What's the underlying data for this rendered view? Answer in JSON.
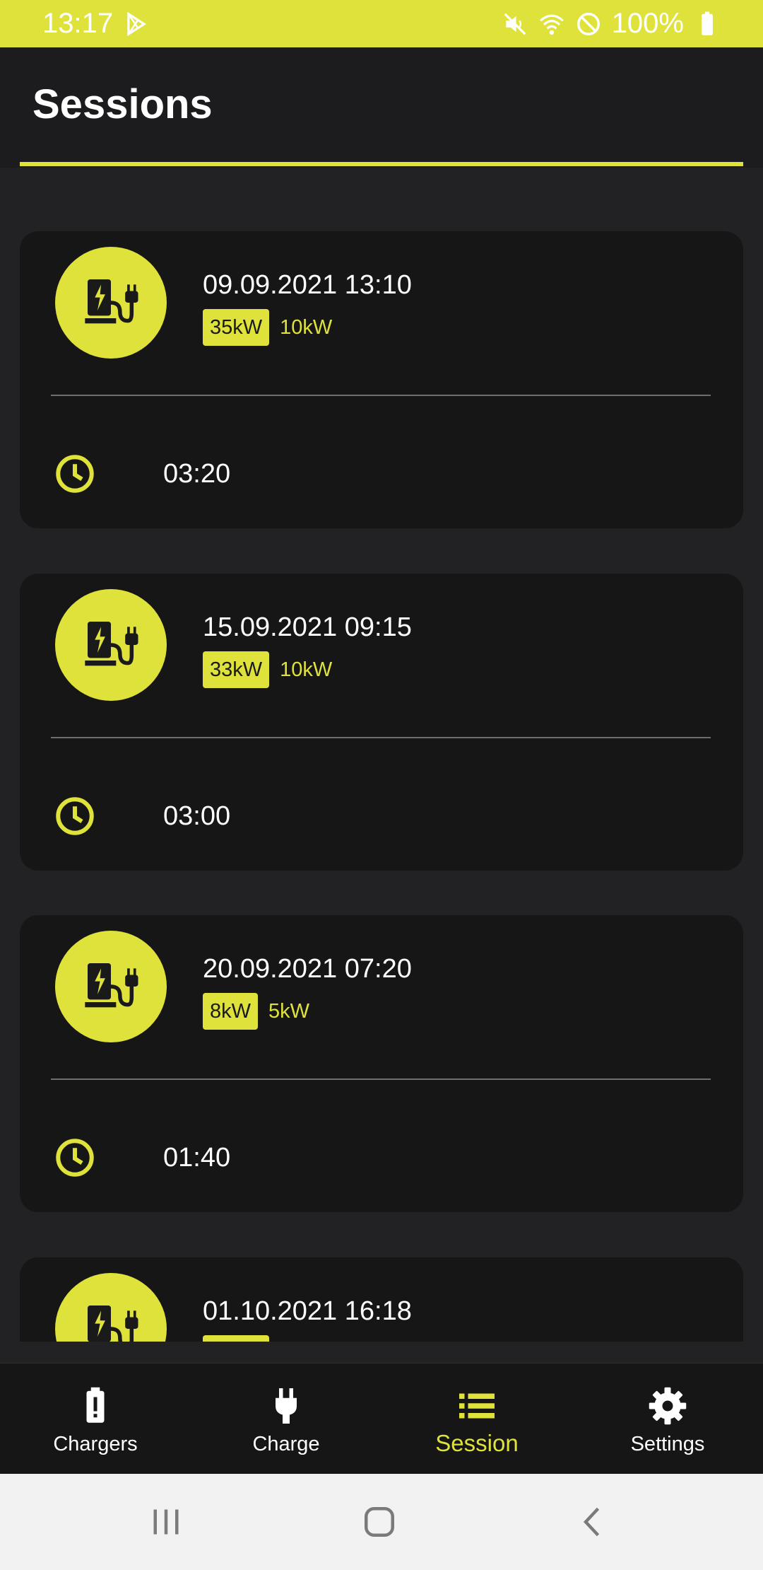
{
  "status_bar": {
    "time": "13:17",
    "battery_percent": "100%",
    "icons": [
      "play-store-icon",
      "mute-icon",
      "wifi-icon",
      "do-not-disturb-icon",
      "battery-icon"
    ]
  },
  "header": {
    "title": "Sessions"
  },
  "sessions": [
    {
      "datetime": "09.09.2021 13:10",
      "power_max": "35kW",
      "power_avg": "10kW",
      "duration": "03:20"
    },
    {
      "datetime": "15.09.2021 09:15",
      "power_max": "33kW",
      "power_avg": "10kW",
      "duration": "03:00"
    },
    {
      "datetime": "20.09.2021 07:20",
      "power_max": "8kW",
      "power_avg": "5kW",
      "duration": "01:40"
    },
    {
      "datetime": "01.10.2021 16:18",
      "power_max": "",
      "power_avg": "",
      "duration": ""
    }
  ],
  "bottom_nav": {
    "items": [
      {
        "label": "Chargers",
        "icon": "charger-battery-icon",
        "active": false
      },
      {
        "label": "Charge",
        "icon": "plug-icon",
        "active": false
      },
      {
        "label": "Session",
        "icon": "list-icon",
        "active": true
      },
      {
        "label": "Settings",
        "icon": "gear-icon",
        "active": false
      }
    ]
  },
  "colors": {
    "accent": "#dfe23a",
    "background": "#222224",
    "card": "#161617",
    "text": "#ffffff"
  }
}
